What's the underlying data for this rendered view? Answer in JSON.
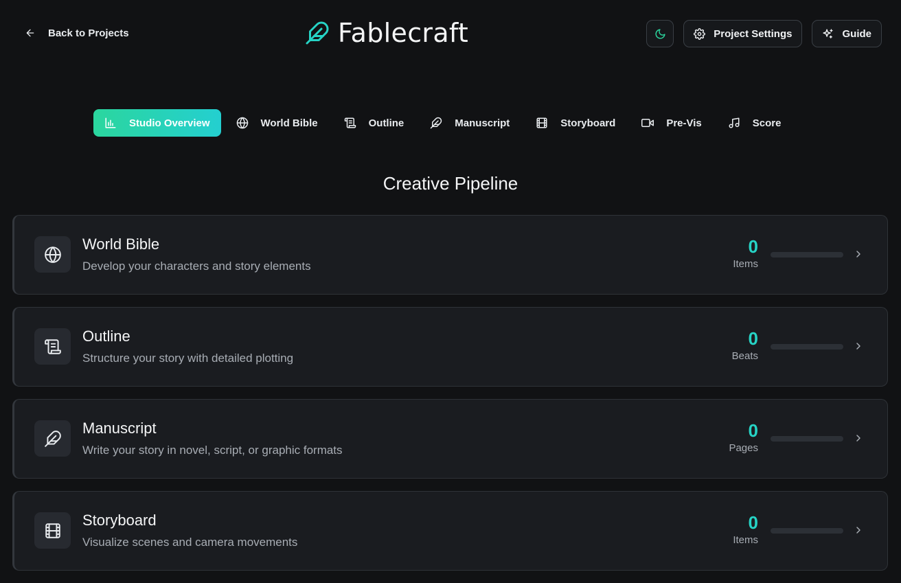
{
  "header": {
    "back_label": "Back to Projects",
    "brand_title": "Fablecraft",
    "project_settings_label": "Project Settings",
    "guide_label": "Guide"
  },
  "tabs": [
    {
      "label": "Studio Overview",
      "icon": "chart-icon",
      "active": true
    },
    {
      "label": "World Bible",
      "icon": "globe-icon",
      "active": false
    },
    {
      "label": "Outline",
      "icon": "scroll-icon",
      "active": false
    },
    {
      "label": "Manuscript",
      "icon": "feather-icon",
      "active": false
    },
    {
      "label": "Storyboard",
      "icon": "film-icon",
      "active": false
    },
    {
      "label": "Pre-Vis",
      "icon": "video-icon",
      "active": false
    },
    {
      "label": "Score",
      "icon": "music-icon",
      "active": false
    }
  ],
  "section_title": "Creative Pipeline",
  "cards": [
    {
      "title": "World Bible",
      "description": "Develop your characters and story elements",
      "count": "0",
      "unit": "Items",
      "progress": 0,
      "icon": "globe-icon"
    },
    {
      "title": "Outline",
      "description": "Structure your story with detailed plotting",
      "count": "0",
      "unit": "Beats",
      "progress": 0,
      "icon": "scroll-icon"
    },
    {
      "title": "Manuscript",
      "description": "Write your story in novel, script, or graphic formats",
      "count": "0",
      "unit": "Pages",
      "progress": 0,
      "icon": "feather-icon"
    },
    {
      "title": "Storyboard",
      "description": "Visualize scenes and camera movements",
      "count": "0",
      "unit": "Items",
      "progress": 0,
      "icon": "film-icon"
    }
  ],
  "colors": {
    "accent": "#26d3c5",
    "accent_gradient_start": "#2bd69e",
    "background": "#111214",
    "card": "#1a1c20"
  }
}
